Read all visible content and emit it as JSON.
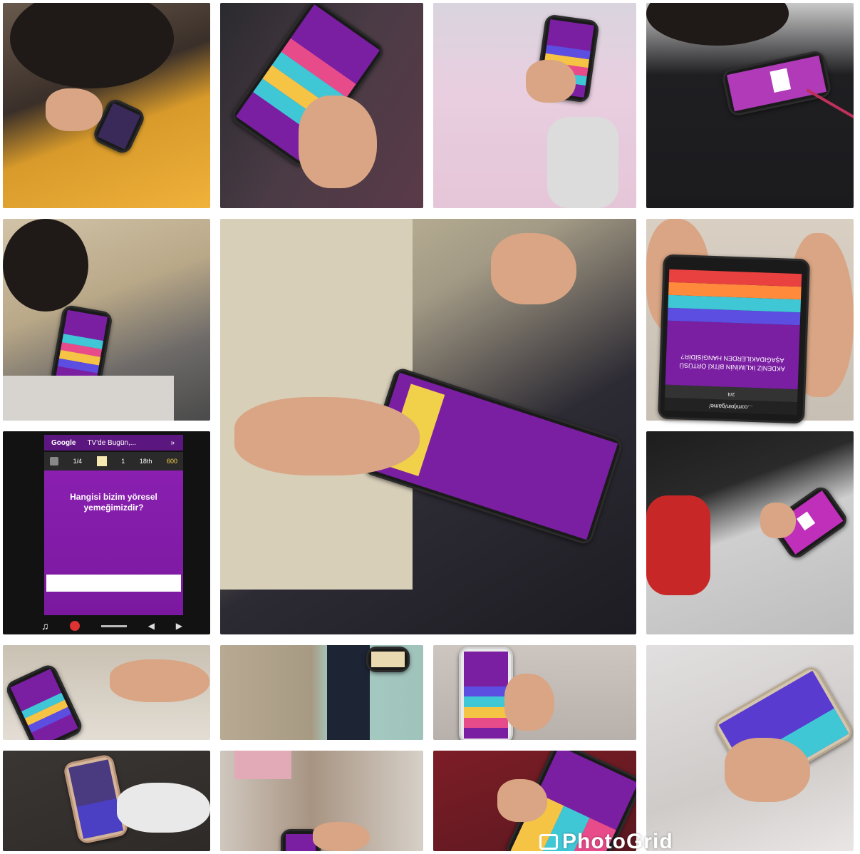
{
  "collage": {
    "description_tiles": 17
  },
  "game_screen": {
    "browser_tabs": [
      "Google",
      "TV'de Bugün,..."
    ],
    "tab_chevron": "»",
    "status": {
      "question_counter": "1/4",
      "streak": "1",
      "rank": "18th",
      "score": "600"
    },
    "question": "Hangisi bizim yöresel yemeğimizdir?"
  },
  "rotated_phone": {
    "question": "AKDENİZ İKLİMİNİN BİTKİ ÖRTÜSÜ AŞAĞIDAKİLERDEN HANGİSİDİR?",
    "url": "...com/join/game/",
    "status_counter": "2/4"
  },
  "watermark": {
    "text": "PhotoGrid"
  },
  "colors": {
    "quiz_purple": "#7a1fa2",
    "answer_pink": "#e84b8a",
    "answer_yellow": "#f6c445",
    "answer_cyan": "#3fc7d6",
    "answer_blue": "#5b4ee0",
    "answer_orange": "#ff8a3c"
  }
}
